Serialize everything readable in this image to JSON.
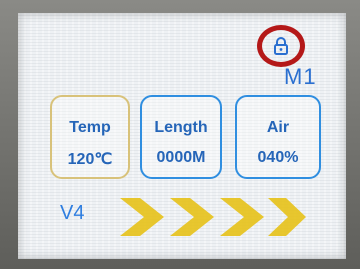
{
  "status": {
    "lock_icon": "lock-icon",
    "mode": "M1"
  },
  "readings": [
    {
      "label": "Temp",
      "value": "120℃"
    },
    {
      "label": "Length",
      "value": "0000M"
    },
    {
      "label": "Air",
      "value": "040%"
    }
  ],
  "footer": {
    "version": "V4",
    "indicator": "chevron-arrows"
  },
  "colors": {
    "accent_blue": "#2f8ee0",
    "text_blue": "#2565b8",
    "highlight_circle": "#b41818",
    "chevron_yellow": "#e6c21c",
    "temp_border": "#d8c27a"
  }
}
